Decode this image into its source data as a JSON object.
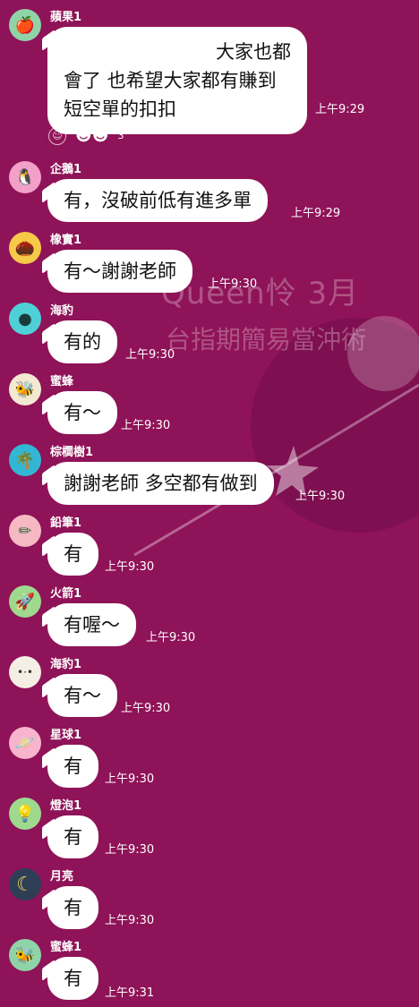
{
  "watermark": {
    "title": "Queen怜  3月",
    "subtitle": "台指期簡易當沖術"
  },
  "messages": [
    {
      "sender": "蘋果1",
      "avatar_icon": "apple-icon",
      "avatar_glyph": "🍎",
      "avatar_bg": "#8fd3a8",
      "lines": [
        "大家也都",
        "會了 也希望大家都有賺到",
        "短空單的扣扣"
      ],
      "time": "上午9:29"
    },
    {
      "sender": "企鵝1",
      "avatar_icon": "penguin-icon",
      "avatar_glyph": "🐧",
      "avatar_bg": "#f2a0c8",
      "text": "有，沒破前低有進多單",
      "time": "上午9:29"
    },
    {
      "sender": "橡實1",
      "avatar_icon": "acorn-icon",
      "avatar_glyph": "🌰",
      "avatar_bg": "#f6c948",
      "text": "有～謝謝老師",
      "time": "上午9:30"
    },
    {
      "sender": "海豹",
      "avatar_icon": "seal-icon",
      "avatar_glyph": "●",
      "avatar_bg": "#4fd0d6",
      "text": "有的",
      "time": "上午9:30"
    },
    {
      "sender": "蜜蜂",
      "avatar_icon": "bee-icon",
      "avatar_glyph": "🐝",
      "avatar_bg": "#f3e9d2",
      "text": "有～",
      "time": "上午9:30"
    },
    {
      "sender": "棕櫚樹1",
      "avatar_icon": "palm-tree-icon",
      "avatar_glyph": "🌴",
      "avatar_bg": "#33b6d4",
      "text": "謝謝老師 多空都有做到",
      "time": "上午9:30"
    },
    {
      "sender": "鉛筆1",
      "avatar_icon": "pencil-icon",
      "avatar_glyph": "✏",
      "avatar_bg": "#f6b9c3",
      "text": "有",
      "time": "上午9:30"
    },
    {
      "sender": "火箭1",
      "avatar_icon": "rocket-icon",
      "avatar_glyph": "🚀",
      "avatar_bg": "#9ed98e",
      "text": "有喔～",
      "time": "上午9:30"
    },
    {
      "sender": "海豹1",
      "avatar_icon": "seal-icon",
      "avatar_glyph": "•·•",
      "avatar_bg": "#f4eee4",
      "text": "有～",
      "time": "上午9:30"
    },
    {
      "sender": "星球1",
      "avatar_icon": "planet-icon",
      "avatar_glyph": "🪐",
      "avatar_bg": "#f7b4cc",
      "text": "有",
      "time": "上午9:30"
    },
    {
      "sender": "燈泡1",
      "avatar_icon": "lightbulb-icon",
      "avatar_glyph": "💡",
      "avatar_bg": "#9ed98e",
      "text": "有",
      "time": "上午9:30"
    },
    {
      "sender": "月亮",
      "avatar_icon": "moon-icon",
      "avatar_glyph": "☾",
      "avatar_bg": "#2d3e55",
      "text": "有",
      "time": "上午9:30"
    },
    {
      "sender": "蜜蜂1",
      "avatar_icon": "bee-icon",
      "avatar_glyph": "🐝",
      "avatar_bg": "#8fd3a8",
      "text": "有",
      "time": "上午9:31"
    }
  ],
  "reactions": {
    "count": "3",
    "add_glyph": "☺",
    "faces_glyph": "☻☻"
  }
}
